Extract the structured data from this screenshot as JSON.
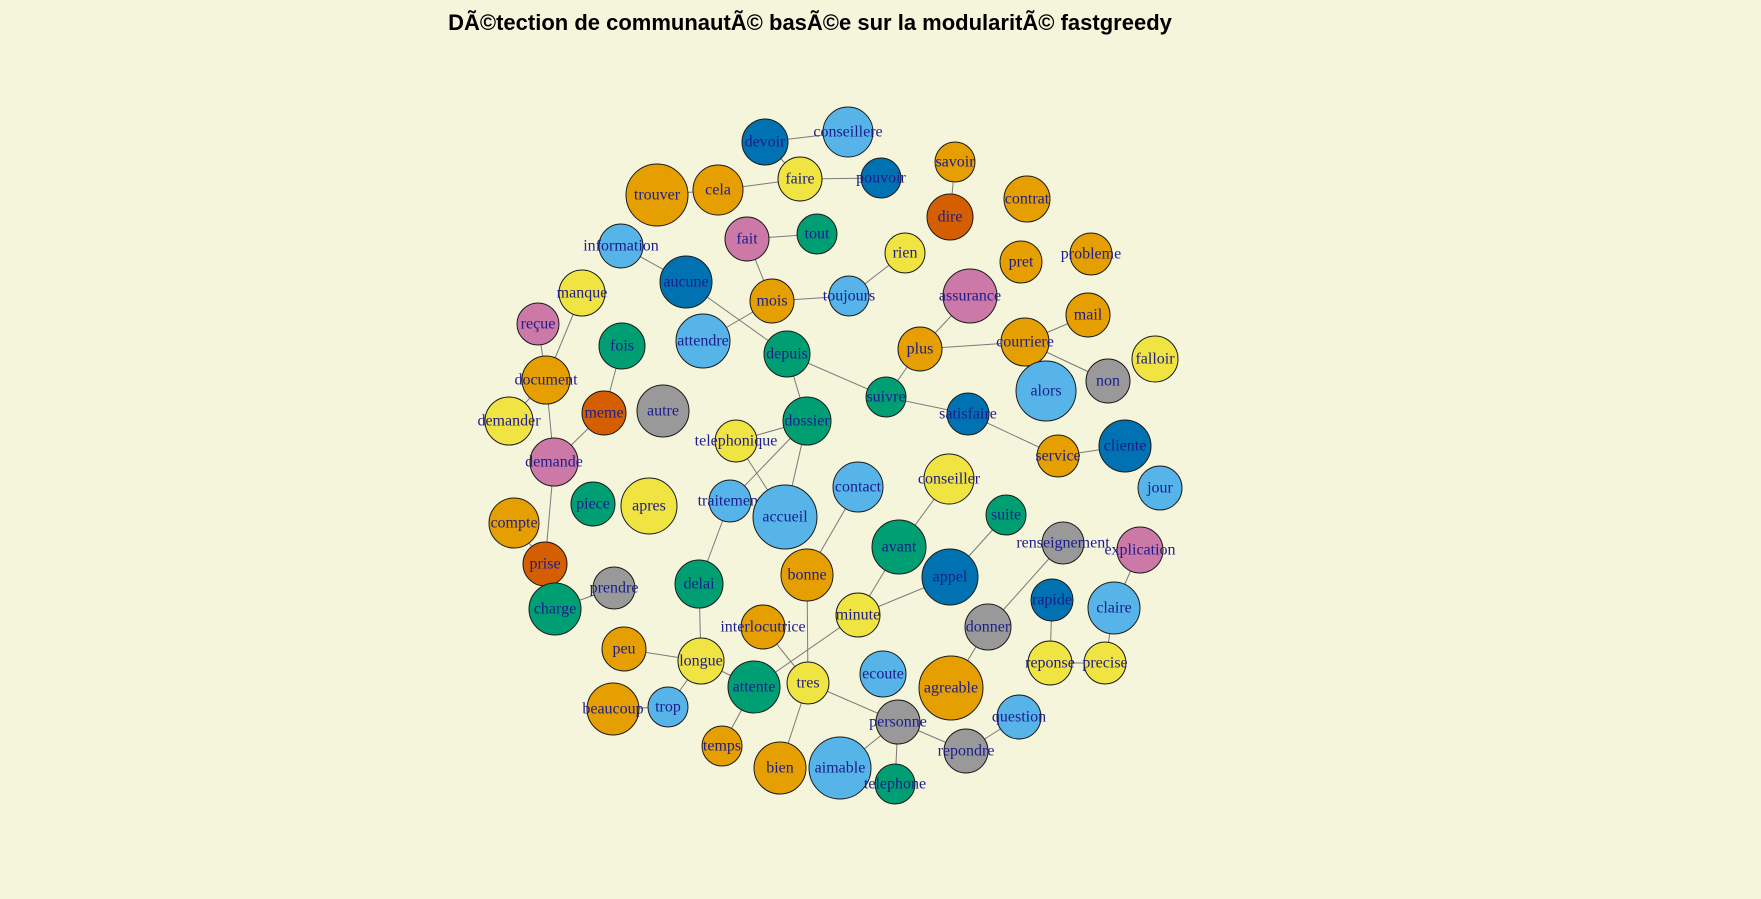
{
  "title": "DÃ©tection de communautÃ© basÃ©e sur la modularitÃ© fastgreedy",
  "community_colors": {
    "orange": "#e69f00",
    "sky_blue": "#56b4e9",
    "green": "#009e73",
    "yellow": "#f0e442",
    "blue": "#0072b2",
    "vermillion": "#d55e00",
    "pink": "#cc79a7",
    "gray": "#999999"
  },
  "nodes": [
    {
      "label": "devoir",
      "community": "blue",
      "size": 23
    },
    {
      "label": "conseillere",
      "community": "sky_blue",
      "size": 25
    },
    {
      "label": "faire",
      "community": "yellow",
      "size": 22
    },
    {
      "label": "pouvoir",
      "community": "blue",
      "size": 20
    },
    {
      "label": "cela",
      "community": "orange",
      "size": 25
    },
    {
      "label": "trouver",
      "community": "orange",
      "size": 31
    },
    {
      "label": "savoir",
      "community": "orange",
      "size": 20
    },
    {
      "label": "contrat",
      "community": "orange",
      "size": 23
    },
    {
      "label": "dire",
      "community": "vermillion",
      "size": 23
    },
    {
      "label": "fait",
      "community": "pink",
      "size": 22
    },
    {
      "label": "tout",
      "community": "green",
      "size": 20
    },
    {
      "label": "information",
      "community": "sky_blue",
      "size": 22
    },
    {
      "label": "rien",
      "community": "yellow",
      "size": 20
    },
    {
      "label": "probleme",
      "community": "orange",
      "size": 21
    },
    {
      "label": "pret",
      "community": "orange",
      "size": 21
    },
    {
      "label": "aucune",
      "community": "blue",
      "size": 26
    },
    {
      "label": "manque",
      "community": "yellow",
      "size": 23
    },
    {
      "label": "mois",
      "community": "orange",
      "size": 22
    },
    {
      "label": "toujours",
      "community": "sky_blue",
      "size": 20
    },
    {
      "label": "assurance",
      "community": "pink",
      "size": 27
    },
    {
      "label": "mail",
      "community": "orange",
      "size": 22
    },
    {
      "label": "reçue",
      "community": "pink",
      "size": 21
    },
    {
      "label": "attendre",
      "community": "sky_blue",
      "size": 27
    },
    {
      "label": "fois",
      "community": "green",
      "size": 23
    },
    {
      "label": "depuis",
      "community": "green",
      "size": 23
    },
    {
      "label": "plus",
      "community": "orange",
      "size": 22
    },
    {
      "label": "courriere",
      "community": "orange",
      "size": 24
    },
    {
      "label": "falloir",
      "community": "yellow",
      "size": 23
    },
    {
      "label": "document",
      "community": "orange",
      "size": 24
    },
    {
      "label": "alors",
      "community": "sky_blue",
      "size": 30
    },
    {
      "label": "non",
      "community": "gray",
      "size": 22
    },
    {
      "label": "meme",
      "community": "vermillion",
      "size": 22
    },
    {
      "label": "autre",
      "community": "gray",
      "size": 26
    },
    {
      "label": "suivre",
      "community": "green",
      "size": 20
    },
    {
      "label": "satisfaire",
      "community": "blue",
      "size": 21
    },
    {
      "label": "demander",
      "community": "yellow",
      "size": 24
    },
    {
      "label": "dossier",
      "community": "green",
      "size": 24
    },
    {
      "label": "telephonique",
      "community": "yellow",
      "size": 21
    },
    {
      "label": "demande",
      "community": "pink",
      "size": 24
    },
    {
      "label": "service",
      "community": "orange",
      "size": 21
    },
    {
      "label": "cliente",
      "community": "blue",
      "size": 26
    },
    {
      "label": "jour",
      "community": "sky_blue",
      "size": 22
    },
    {
      "label": "conseiller",
      "community": "yellow",
      "size": 25
    },
    {
      "label": "contact",
      "community": "sky_blue",
      "size": 25
    },
    {
      "label": "piece",
      "community": "green",
      "size": 22
    },
    {
      "label": "apres",
      "community": "yellow",
      "size": 28
    },
    {
      "label": "traitement",
      "community": "sky_blue",
      "size": 21
    },
    {
      "label": "accueil",
      "community": "sky_blue",
      "size": 32
    },
    {
      "label": "suite",
      "community": "green",
      "size": 20
    },
    {
      "label": "compte",
      "community": "orange",
      "size": 25
    },
    {
      "label": "renseignement",
      "community": "gray",
      "size": 21
    },
    {
      "label": "explication",
      "community": "pink",
      "size": 23
    },
    {
      "label": "avant",
      "community": "green",
      "size": 27
    },
    {
      "label": "prise",
      "community": "vermillion",
      "size": 22
    },
    {
      "label": "bonne",
      "community": "orange",
      "size": 26
    },
    {
      "label": "appel",
      "community": "blue",
      "size": 28
    },
    {
      "label": "delai",
      "community": "green",
      "size": 24
    },
    {
      "label": "prendre",
      "community": "gray",
      "size": 21
    },
    {
      "label": "charge",
      "community": "green",
      "size": 26
    },
    {
      "label": "rapide",
      "community": "blue",
      "size": 21
    },
    {
      "label": "claire",
      "community": "sky_blue",
      "size": 26
    },
    {
      "label": "interlocutrice",
      "community": "orange",
      "size": 22
    },
    {
      "label": "minute",
      "community": "yellow",
      "size": 22
    },
    {
      "label": "donner",
      "community": "gray",
      "size": 23
    },
    {
      "label": "peu",
      "community": "orange",
      "size": 22
    },
    {
      "label": "longue",
      "community": "yellow",
      "size": 23
    },
    {
      "label": "reponse",
      "community": "yellow",
      "size": 22
    },
    {
      "label": "precise",
      "community": "yellow",
      "size": 21
    },
    {
      "label": "attente",
      "community": "green",
      "size": 26
    },
    {
      "label": "tres",
      "community": "yellow",
      "size": 21
    },
    {
      "label": "ecoute",
      "community": "sky_blue",
      "size": 23
    },
    {
      "label": "agreable",
      "community": "orange",
      "size": 32
    },
    {
      "label": "beaucoup",
      "community": "orange",
      "size": 26
    },
    {
      "label": "trop",
      "community": "sky_blue",
      "size": 20
    },
    {
      "label": "personne",
      "community": "gray",
      "size": 22
    },
    {
      "label": "question",
      "community": "sky_blue",
      "size": 22
    },
    {
      "label": "repondre",
      "community": "gray",
      "size": 22
    },
    {
      "label": "temps",
      "community": "orange",
      "size": 20
    },
    {
      "label": "bien",
      "community": "orange",
      "size": 26
    },
    {
      "label": "aimable",
      "community": "sky_blue",
      "size": 31
    },
    {
      "label": "telephone",
      "community": "green",
      "size": 20
    }
  ],
  "edges": [
    [
      "devoir",
      "conseillere"
    ],
    [
      "devoir",
      "faire"
    ],
    [
      "faire",
      "pouvoir"
    ],
    [
      "cela",
      "faire"
    ],
    [
      "trouver",
      "cela"
    ],
    [
      "savoir",
      "dire"
    ],
    [
      "fait",
      "tout"
    ],
    [
      "fait",
      "mois"
    ],
    [
      "information",
      "aucune"
    ],
    [
      "aucune",
      "depuis"
    ],
    [
      "mois",
      "toujours"
    ],
    [
      "mois",
      "attendre"
    ],
    [
      "toujours",
      "rien"
    ],
    [
      "assurance",
      "plus"
    ],
    [
      "plus",
      "courriere"
    ],
    [
      "courriere",
      "mail"
    ],
    [
      "courriere",
      "non"
    ],
    [
      "depuis",
      "dossier"
    ],
    [
      "depuis",
      "suivre"
    ],
    [
      "suivre",
      "plus"
    ],
    [
      "suivre",
      "satisfaire"
    ],
    [
      "satisfaire",
      "service"
    ],
    [
      "service",
      "cliente"
    ],
    [
      "manque",
      "document"
    ],
    [
      "reçue",
      "document"
    ],
    [
      "document",
      "demander"
    ],
    [
      "document",
      "demande"
    ],
    [
      "demande",
      "meme"
    ],
    [
      "meme",
      "fois"
    ],
    [
      "demande",
      "prise"
    ],
    [
      "prise",
      "charge"
    ],
    [
      "charge",
      "prendre"
    ],
    [
      "compte",
      "prise"
    ],
    [
      "dossier",
      "telephonique"
    ],
    [
      "dossier",
      "traitement"
    ],
    [
      "telephonique",
      "accueil"
    ],
    [
      "traitement",
      "delai"
    ],
    [
      "delai",
      "longue"
    ],
    [
      "longue",
      "attente"
    ],
    [
      "longue",
      "peu"
    ],
    [
      "longue",
      "trop"
    ],
    [
      "trop",
      "beaucoup"
    ],
    [
      "attente",
      "temps"
    ],
    [
      "attente",
      "minute"
    ],
    [
      "minute",
      "avant"
    ],
    [
      "minute",
      "appel"
    ],
    [
      "avant",
      "conseiller"
    ],
    [
      "bonne",
      "contact"
    ],
    [
      "bonne",
      "tres"
    ],
    [
      "interlocutrice",
      "tres"
    ],
    [
      "tres",
      "personne"
    ],
    [
      "tres",
      "bien"
    ],
    [
      "personne",
      "aimable"
    ],
    [
      "personne",
      "telephone"
    ],
    [
      "personne",
      "repondre"
    ],
    [
      "agreable",
      "donner"
    ],
    [
      "donner",
      "renseignement"
    ],
    [
      "rapide",
      "reponse"
    ],
    [
      "reponse",
      "precise"
    ],
    [
      "precise",
      "claire"
    ],
    [
      "claire",
      "explication"
    ],
    [
      "repondre",
      "question"
    ],
    [
      "suite",
      "appel"
    ],
    [
      "dossier",
      "accueil"
    ]
  ]
}
